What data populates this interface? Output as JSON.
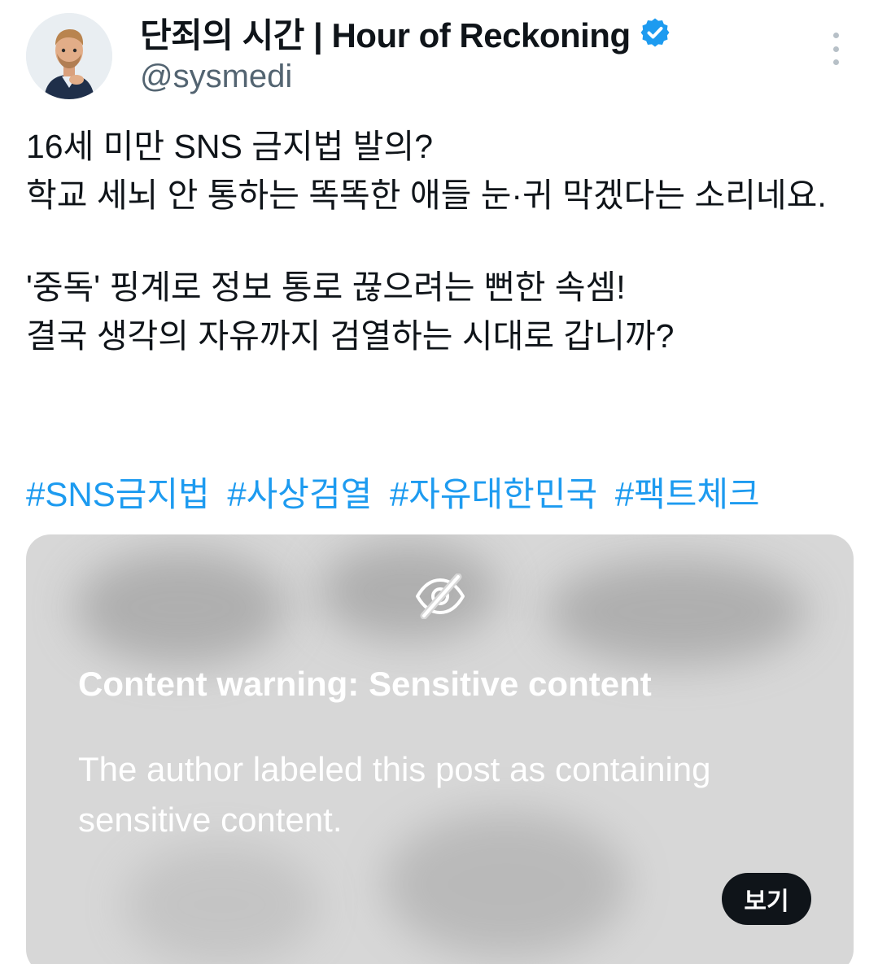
{
  "author": {
    "display_name": "단죄의 시간 | Hour of Reckoning",
    "handle": "@sysmedi",
    "avatar_icon": "memoji-avatar-icon",
    "verified_icon": "verified-badge-icon",
    "verified_color": "#1d9bf0"
  },
  "post": {
    "lines": [
      "16세 미만 SNS 금지법 발의?",
      "학교 세뇌 안 통하는 똑똑한 애들 눈·귀 막겠다는 소리네요.",
      "'중독' 핑계로 정보 통로 끊으려는 뻔한 속셈!",
      "결국 생각의 자유까지 검열하는 시대로 갑니까?"
    ],
    "hashtags": [
      "#SNS금지법",
      "#사상검열",
      "#자유대한민국",
      "#팩트체크"
    ],
    "hashtag_color": "#1d9bf0"
  },
  "media": {
    "warning_icon": "eye-slash-icon",
    "warning_title": "Content warning: Sensitive content",
    "warning_description": "The author labeled this post as containing sensitive content.",
    "view_button_label": "보기"
  },
  "menu": {
    "more_icon": "more-options-icon"
  }
}
